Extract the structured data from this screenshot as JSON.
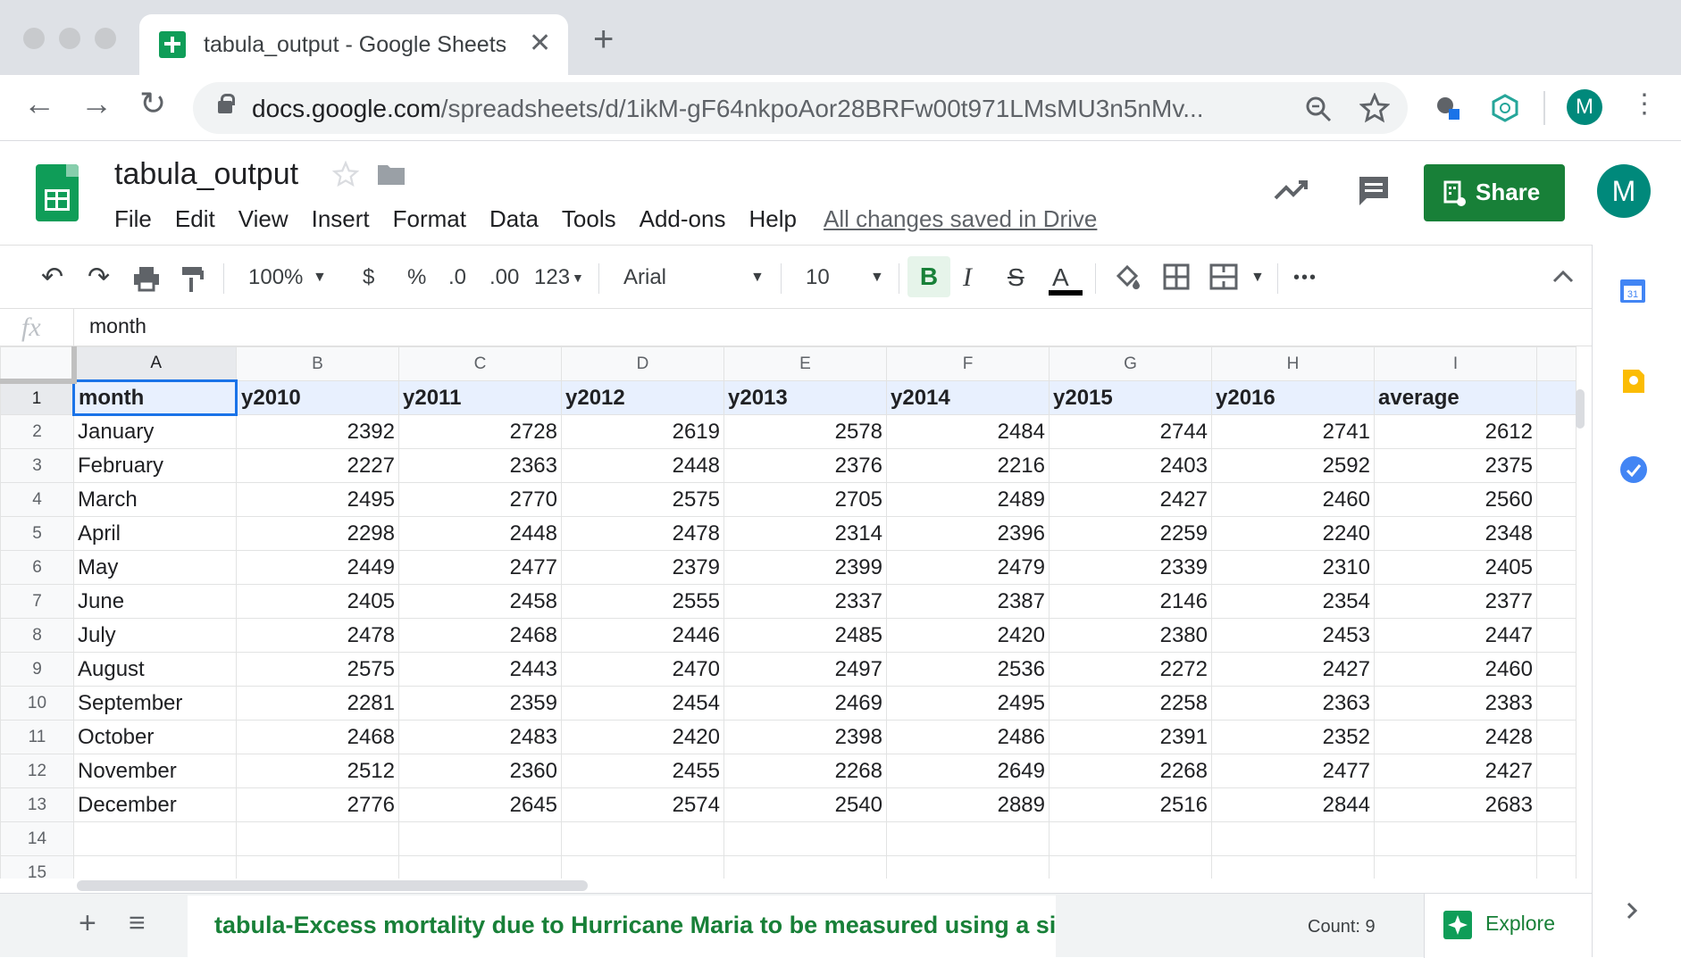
{
  "browser": {
    "tab_title": "tabula_output - Google Sheets",
    "tab_close": "✕",
    "new_tab": "+",
    "url_host": "docs.google.com",
    "url_path": "/spreadsheets/d/1ikM-gF64nkpoAor28BRFw00t971LMsMU3n5nMv...",
    "profile_initial": "M"
  },
  "doc": {
    "title": "tabula_output",
    "menu": [
      "File",
      "Edit",
      "View",
      "Insert",
      "Format",
      "Data",
      "Tools",
      "Add-ons",
      "Help"
    ],
    "save_status": "All changes saved in Drive",
    "share_label": "Share",
    "account_initial": "M"
  },
  "toolbar": {
    "zoom": "100%",
    "currency": "$",
    "percent": "%",
    "dec_less": ".0",
    "dec_more": ".00",
    "format_more": "123",
    "font": "Arial",
    "font_size": "10",
    "bold": "B",
    "italic": "I",
    "strike": "S",
    "text_color": "A",
    "more": "•••"
  },
  "formula": {
    "fx": "fx",
    "value": "month"
  },
  "grid": {
    "columns": [
      "A",
      "B",
      "C",
      "D",
      "E",
      "F",
      "G",
      "H",
      "I"
    ],
    "rows": [
      [
        "month",
        "y2010",
        "y2011",
        "y2012",
        "y2013",
        "y2014",
        "y2015",
        "y2016",
        "average"
      ],
      [
        "January",
        "2392",
        "2728",
        "2619",
        "2578",
        "2484",
        "2744",
        "2741",
        "2612"
      ],
      [
        "February",
        "2227",
        "2363",
        "2448",
        "2376",
        "2216",
        "2403",
        "2592",
        "2375"
      ],
      [
        "March",
        "2495",
        "2770",
        "2575",
        "2705",
        "2489",
        "2427",
        "2460",
        "2560"
      ],
      [
        "April",
        "2298",
        "2448",
        "2478",
        "2314",
        "2396",
        "2259",
        "2240",
        "2348"
      ],
      [
        "May",
        "2449",
        "2477",
        "2379",
        "2399",
        "2479",
        "2339",
        "2310",
        "2405"
      ],
      [
        "June",
        "2405",
        "2458",
        "2555",
        "2337",
        "2387",
        "2146",
        "2354",
        "2377"
      ],
      [
        "July",
        "2478",
        "2468",
        "2446",
        "2485",
        "2420",
        "2380",
        "2453",
        "2447"
      ],
      [
        "August",
        "2575",
        "2443",
        "2470",
        "2497",
        "2536",
        "2272",
        "2427",
        "2460"
      ],
      [
        "September",
        "2281",
        "2359",
        "2454",
        "2469",
        "2495",
        "2258",
        "2363",
        "2383"
      ],
      [
        "October",
        "2468",
        "2483",
        "2420",
        "2398",
        "2486",
        "2391",
        "2352",
        "2428"
      ],
      [
        "November",
        "2512",
        "2360",
        "2455",
        "2268",
        "2649",
        "2268",
        "2477",
        "2427"
      ],
      [
        "December",
        "2776",
        "2645",
        "2574",
        "2540",
        "2889",
        "2516",
        "2844",
        "2683"
      ],
      [
        "",
        "",
        "",
        "",
        "",
        "",
        "",
        "",
        ""
      ],
      [
        "",
        "",
        "",
        "",
        "",
        "",
        "",
        "",
        ""
      ]
    ],
    "row_numbers": [
      "1",
      "2",
      "3",
      "4",
      "5",
      "6",
      "7",
      "8",
      "9",
      "10",
      "11",
      "12",
      "13",
      "14",
      "15"
    ]
  },
  "bottom": {
    "add_sheet": "+",
    "all_sheets": "≡",
    "sheet_tab": "tabula-Excess mortality due to Hurricane Maria to be measured using a simp",
    "count": "Count: 9",
    "explore": "Explore"
  },
  "colors": {
    "sheets_green": "#0f9d58",
    "share_green": "#188038",
    "selection_blue": "#1a73e8",
    "header_fill": "#e8f0fe"
  }
}
